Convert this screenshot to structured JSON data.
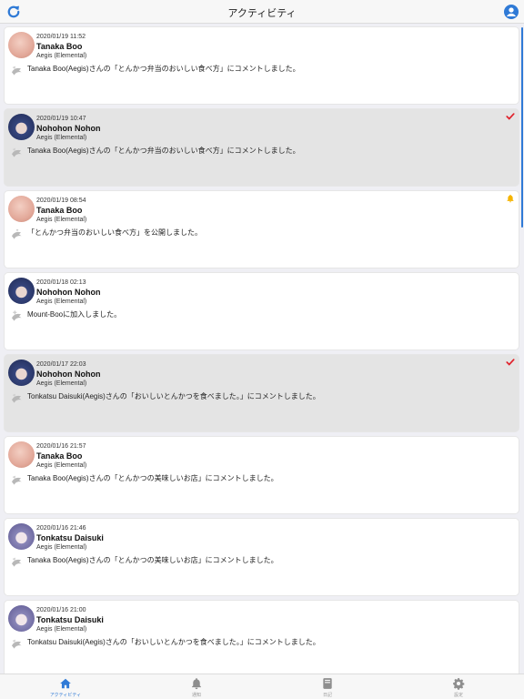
{
  "header": {
    "title": "アクティビティ",
    "left_icon": "refresh-icon",
    "right_icon": "user-account-icon"
  },
  "colors": {
    "accent": "#2f7ad6",
    "check": "#e0202a",
    "bell": "#f5b400",
    "read_bg": "#e4e4e4"
  },
  "activities": [
    {
      "time": "2020/01/19 11:52",
      "name": "Tanaka Boo",
      "world": "Aegis (Elemental)",
      "message": "Tanaka Boo(Aegis)さんの「とんかつ弁当のおいしい食べ方」にコメントしました。",
      "avatar": "pig",
      "kind_icon": "comment-icon",
      "read": false,
      "mark": ""
    },
    {
      "time": "2020/01/19 10:47",
      "name": "Nohohon Nohon",
      "world": "Aegis (Elemental)",
      "message": "Tanaka Boo(Aegis)さんの「とんかつ弁当のおいしい食べ方」にコメントしました。",
      "avatar": "dark",
      "kind_icon": "comment-icon",
      "read": true,
      "mark": "check"
    },
    {
      "time": "2020/01/19 08:54",
      "name": "Tanaka Boo",
      "world": "Aegis (Elemental)",
      "message": "「とんかつ弁当のおいしい食べ方」を公開しました。",
      "avatar": "pig",
      "kind_icon": "publish-icon",
      "read": false,
      "mark": "bell"
    },
    {
      "time": "2020/01/18 02:13",
      "name": "Nohohon Nohon",
      "world": "Aegis (Elemental)",
      "message": "Mount-Booに加入しました。",
      "avatar": "dark",
      "kind_icon": "join-icon",
      "read": false,
      "mark": ""
    },
    {
      "time": "2020/01/17 22:03",
      "name": "Nohohon Nohon",
      "world": "Aegis (Elemental)",
      "message": "Tonkatsu Daisuki(Aegis)さんの「おいしいとんかつを食べました。」にコメントしました。",
      "avatar": "dark",
      "kind_icon": "comment-icon",
      "read": true,
      "mark": "check"
    },
    {
      "time": "2020/01/16 21:57",
      "name": "Tanaka Boo",
      "world": "Aegis (Elemental)",
      "message": "Tanaka Boo(Aegis)さんの「とんかつの美味しいお店」にコメントしました。",
      "avatar": "pig",
      "kind_icon": "comment-icon",
      "read": false,
      "mark": ""
    },
    {
      "time": "2020/01/16 21:46",
      "name": "Tonkatsu Daisuki",
      "world": "Aegis (Elemental)",
      "message": "Tanaka Boo(Aegis)さんの「とんかつの美味しいお店」にコメントしました。",
      "avatar": "silver",
      "kind_icon": "comment-icon",
      "read": false,
      "mark": ""
    },
    {
      "time": "2020/01/16 21:00",
      "name": "Tonkatsu Daisuki",
      "world": "Aegis (Elemental)",
      "message": "Tonkatsu Daisuki(Aegis)さんの「おいしいとんかつを食べました。」にコメントしました。",
      "avatar": "silver",
      "kind_icon": "comment-icon",
      "read": false,
      "mark": ""
    }
  ],
  "tabs": [
    {
      "label": "アクティビティ",
      "icon": "home-icon",
      "active": true
    },
    {
      "label": "通知",
      "icon": "bell-icon",
      "active": false
    },
    {
      "label": "日記",
      "icon": "book-icon",
      "active": false
    },
    {
      "label": "設定",
      "icon": "gear-icon",
      "active": false
    }
  ]
}
